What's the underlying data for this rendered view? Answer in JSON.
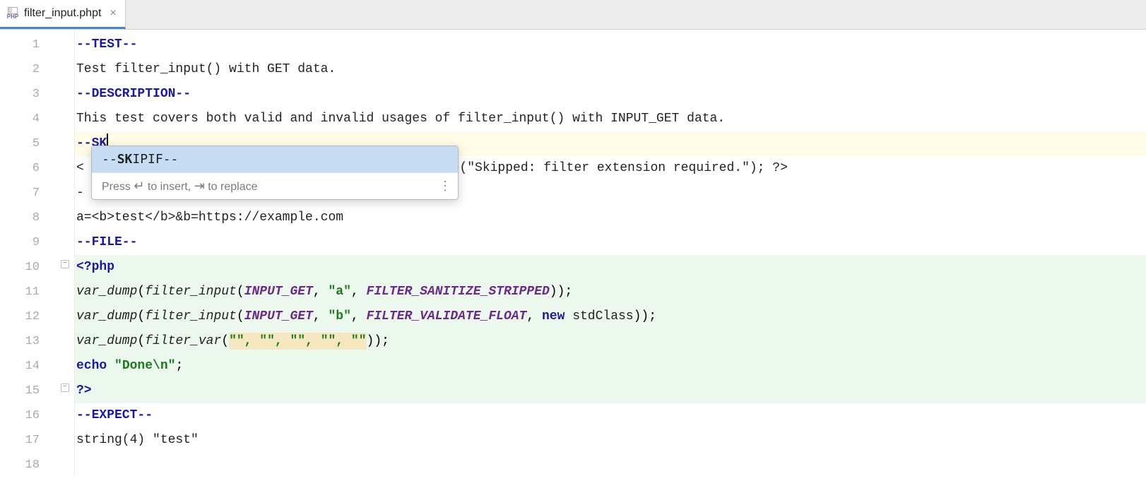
{
  "tab": {
    "label": "filter_input.phpt",
    "icon_name": "php-file-icon",
    "php_badge": "PHP"
  },
  "gutter": {
    "lines": [
      "1",
      "2",
      "3",
      "4",
      "5",
      "6",
      "7",
      "8",
      "9",
      "10",
      "11",
      "12",
      "13",
      "14",
      "15",
      "16",
      "17",
      "18"
    ]
  },
  "code": {
    "l1": "--TEST--",
    "l2": "Test filter_input() with GET data.",
    "l3": "--DESCRIPTION--",
    "l4": "This test covers both valid and invalid usages of filter_input() with INPUT_GET data.",
    "l5": "--SK",
    "l6_pre": "<",
    "l6_post": "ie(\"Skipped: filter extension required.\"); ?>",
    "l7": "-",
    "l8": "a=<b>test</b>&b=https://example.com",
    "l9": "--FILE--",
    "l10": "<?php",
    "l11": {
      "fn1": "var_dump",
      "op": "(",
      "fn2": "filter_input",
      "op2": "(",
      "c1": "INPUT_GET",
      "comma1": ", ",
      "s1": "\"a\"",
      "comma2": ", ",
      "c2": "FILTER_SANITIZE_STRIPPED",
      "close": "));"
    },
    "l12": {
      "fn1": "var_dump",
      "op": "(",
      "fn2": "filter_input",
      "op2": "(",
      "c1": "INPUT_GET",
      "comma1": ", ",
      "s1": "\"b\"",
      "comma2": ", ",
      "c2": "FILTER_VALIDATE_FLOAT",
      "comma3": ", ",
      "kw": "new",
      "sp": " ",
      "cls": "stdClass",
      "close": "));"
    },
    "l13": {
      "fn1": "var_dump",
      "op": "(",
      "fn2": "filter_var",
      "op2": "(",
      "args": "\"\", \"\", \"\", \"\", \"\"",
      "close": "));"
    },
    "l14": {
      "kw": "echo",
      "sp": " ",
      "s": "\"Done\\n\"",
      "semi": ";"
    },
    "l15": "?>",
    "l16": "--EXPECT--",
    "l17": "string(4) \"test\""
  },
  "completion": {
    "item_prefix": "--",
    "item_match": "SK",
    "item_rest": "IPIF--",
    "hint_pre": "Press ",
    "hint_enter": "↵",
    "hint_mid": " to insert, ",
    "hint_tab": "⇥",
    "hint_post": " to replace",
    "menu": "⋮"
  }
}
